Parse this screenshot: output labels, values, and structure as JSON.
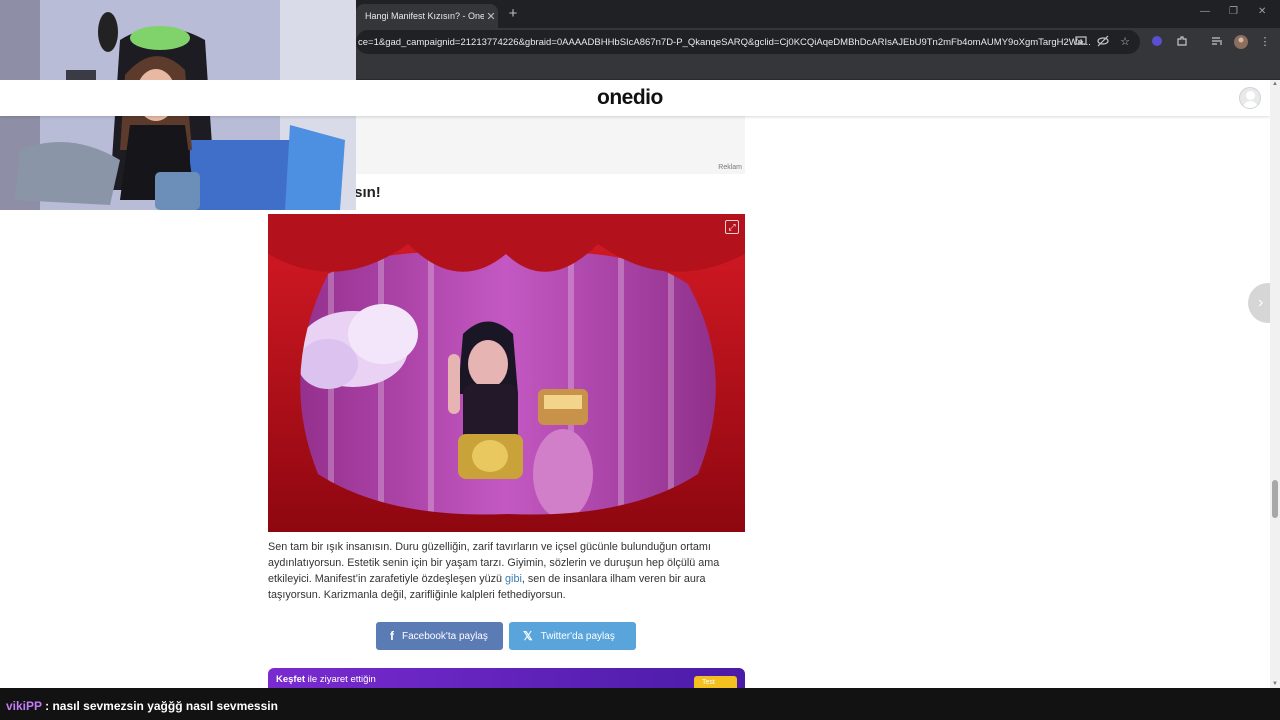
{
  "browser": {
    "tab_title": "Hangi Manifest Kızısın? - Onedio",
    "tab_close": "✕",
    "new_tab": "+",
    "url": "ce=1&gad_campaignid=21213774226&gbraid=0AAAADBHHbSIcA867n7D-P_QkanqeSARQ&gclid=Cj0KCQiAqeDMBhDcARIsAJEbU9Tn2mFb4omAUMY9oXgmTargH2Wn...",
    "window_controls": [
      "—",
      "❐",
      "✕"
    ]
  },
  "site": {
    "logo": "onedio"
  },
  "ad": {
    "label": "Reklam"
  },
  "article": {
    "heading": "Sude Oktay'sın!",
    "paragraph_1": "Sen tam bir ışık insanısın. Duru güzelliğin, zarif tavırların ve içsel gücünle bulunduğun ortamı aydınlatıyorsun. Estetik senin için bir yaşam tarzı. Giyimin, sözlerin ve duruşun hep ölçülü ama etkileyici. Manifest’in zarafetiyle özdeşleşen yüzü ",
    "link_text": "gibi",
    "paragraph_2": ", sen de insanlara ilham veren bir aura taşıyorsun. Karizmanla değil, zarifliğinle kalpleri fethediyorsun."
  },
  "share": {
    "facebook_label": "Facebook'ta paylaş",
    "twitter_label": "Twitter'da paylaş"
  },
  "discover": {
    "bold": "Keşfet",
    "rest": " ile ziyaret ettiğin",
    "badge": "Test"
  },
  "chat": {
    "username": "vikiPP",
    "message": " : nasıl sevmezsin yağğğ nasıl sevmessin"
  },
  "colors": {
    "facebook": "#5b7bb5",
    "twitter": "#5aa4dc",
    "discover_start": "#7a2bd0",
    "discover_end": "#4a1ba7",
    "chat_username": "#c37cf6"
  }
}
